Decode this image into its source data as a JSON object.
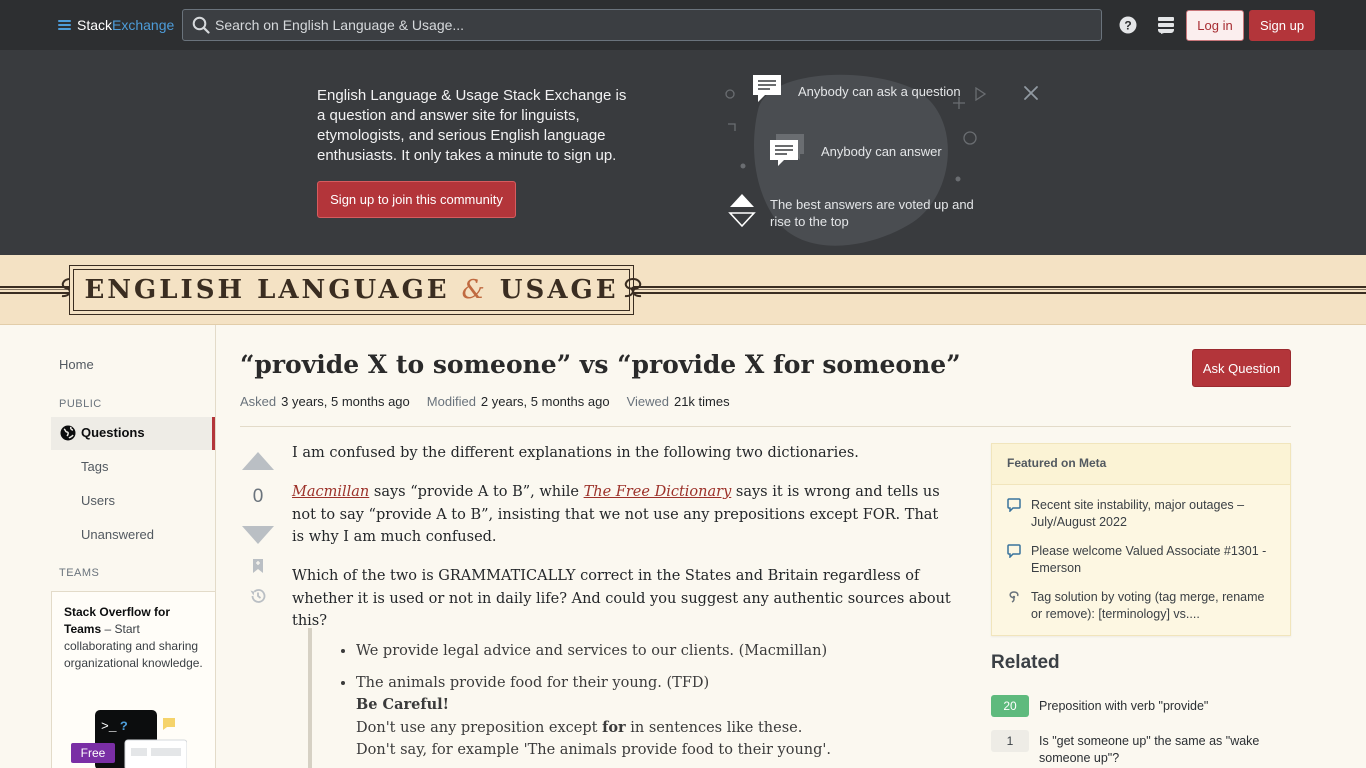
{
  "topbar": {
    "logo_stack": "Stack",
    "logo_exchange": "Exchange",
    "search_placeholder": "Search on English Language & Usage...",
    "login_label": "Log in",
    "signup_label": "Sign up",
    "colors": {
      "bar": "#2d2f31",
      "accent": "#b3353a",
      "logo_blue": "#4d9cd9"
    }
  },
  "hero": {
    "text": "English Language & Usage Stack Exchange is a question and answer site for linguists, etymologists, and serious English language enthusiasts. It only takes a minute to sign up.",
    "cta_label": "Sign up to join this community",
    "features": [
      {
        "icon": "speech-bubble-icon",
        "text": "Anybody can ask a question"
      },
      {
        "icon": "answer-bubbles-icon",
        "text": "Anybody can answer"
      },
      {
        "icon": "vote-arrows-icon",
        "text": "The best answers are voted up and rise to the top"
      }
    ]
  },
  "site_banner": {
    "title_left": "ENGLISH LANGUAGE",
    "title_amp": "&",
    "title_right": "USAGE"
  },
  "leftnav": {
    "home": "Home",
    "public_heading": "PUBLIC",
    "questions": "Questions",
    "tags": "Tags",
    "users": "Users",
    "unanswered": "Unanswered",
    "teams_heading": "TEAMS",
    "teams_title": "Stack Overflow for Teams",
    "teams_text": " – Start collaborating and sharing organizational knowledge.",
    "free_badge": "Free"
  },
  "question": {
    "title": "“provide X to someone” vs “provide X for someone”",
    "ask_button": "Ask Question",
    "asked_label": "Asked",
    "asked_value": "3 years, 5 months ago",
    "modified_label": "Modified",
    "modified_value": "2 years, 5 months ago",
    "viewed_label": "Viewed",
    "viewed_value": "21k times",
    "vote_count": "0",
    "para1": "I am confused by the different explanations in the following two dictionaries.",
    "para2_link1": "Macmillan",
    "para2_mid": " says “provide A to B”, while ",
    "para2_link2": "The Free Dictionary",
    "para2_end": " says it is wrong and tells us not to say “provide A to B”, insisting that we not use any prepositions except FOR. That is why I am much confused.",
    "para3": "Which of the two is GRAMMATICALLY correct in the States and Britain regardless of whether it is used or not in daily life? And could you suggest any authentic sources about this?",
    "quote_item1": "We provide legal advice and services to our clients. (Macmillan)",
    "quote_item2": "The animals provide food for their young. (TFD)",
    "quote_careful": "Be Careful!",
    "quote_line3_a": "Don't use any preposition except ",
    "quote_line3_b": "for",
    "quote_line3_c": " in sentences like these.",
    "quote_line4": "Don't say, for example 'The animals provide food to their young'."
  },
  "sidebar": {
    "meta_heading": "Featured on Meta",
    "meta_items": [
      {
        "icon": "meta-bubble-icon",
        "text": "Recent site instability, major outages – July/August 2022"
      },
      {
        "icon": "meta-bubble-icon",
        "text": "Please welcome Valued Associate #1301 - Emerson"
      },
      {
        "icon": "stack-exchange-icon",
        "text": "Tag solution by voting (tag merge, rename or remove): [terminology] vs...."
      }
    ],
    "related_heading": "Related",
    "related": [
      {
        "score": "20",
        "answered": true,
        "title": "Preposition with verb \"provide\""
      },
      {
        "score": "1",
        "answered": false,
        "title": "Is \"get someone up\" the same as \"wake someone up\"?"
      }
    ]
  }
}
